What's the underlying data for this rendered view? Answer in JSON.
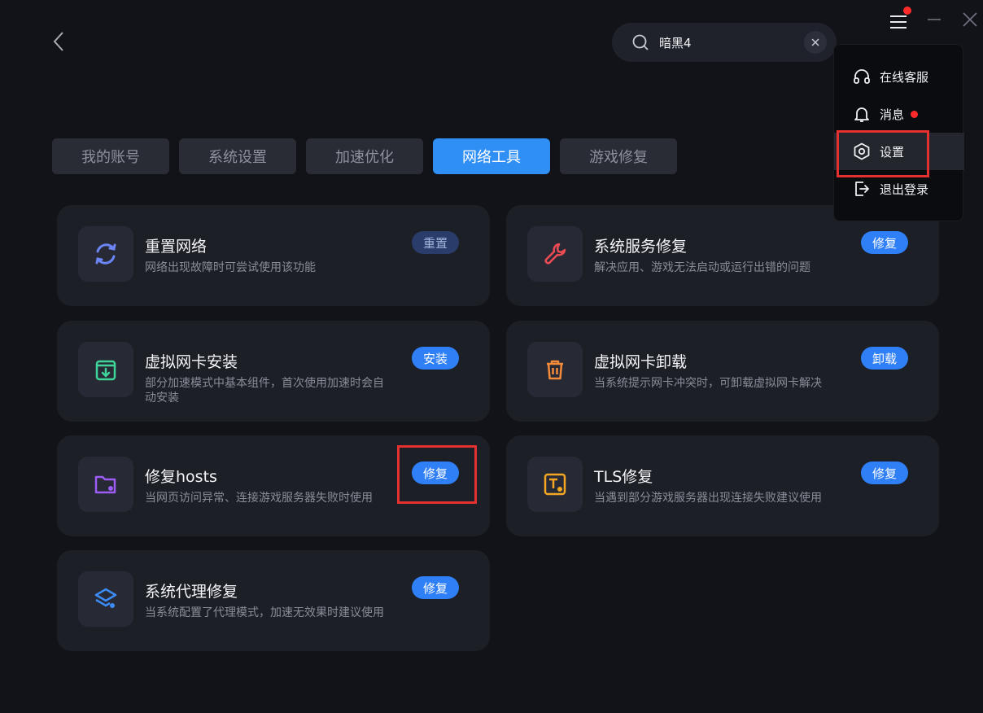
{
  "search": {
    "query": "暗黑4"
  },
  "tabs": [
    {
      "label": "我的账号"
    },
    {
      "label": "系统设置"
    },
    {
      "label": "加速优化"
    },
    {
      "label": "网络工具"
    },
    {
      "label": "游戏修复"
    }
  ],
  "cards": [
    {
      "title": "重置网络",
      "desc": "网络出现故障时可尝试使用该功能",
      "action": "重置"
    },
    {
      "title": "系统服务修复",
      "desc": "解决应用、游戏无法启动或运行出错的问题",
      "action": "修复"
    },
    {
      "title": "虚拟网卡安装",
      "desc": "部分加速模式中基本组件，首次使用加速时会自动安装",
      "action": "安装"
    },
    {
      "title": "虚拟网卡卸载",
      "desc": "当系统提示网卡冲突时，可卸载虚拟网卡解决",
      "action": "卸载"
    },
    {
      "title": "修复hosts",
      "desc": "当网页访问异常、连接游戏服务器失败时使用",
      "action": "修复"
    },
    {
      "title": "TLS修复",
      "desc": "当遇到部分游戏服务器出现连接失败建议使用",
      "action": "修复"
    },
    {
      "title": "系统代理修复",
      "desc": "当系统配置了代理模式，加速无效果时建议使用",
      "action": "修复"
    }
  ],
  "menu": {
    "items": [
      {
        "label": "在线客服"
      },
      {
        "label": "消息"
      },
      {
        "label": "设置"
      },
      {
        "label": "退出登录"
      }
    ]
  },
  "colors": {
    "accent": "#2f8ff4",
    "background": "#121318",
    "card": "#1d1f27",
    "highlight": "#e2312f"
  }
}
